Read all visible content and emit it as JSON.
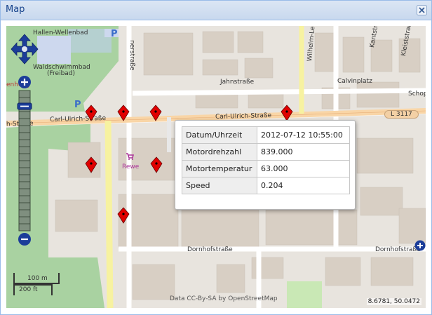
{
  "window": {
    "title": "Map"
  },
  "streets": {
    "hallenbad": "Hallen-Wellenbad",
    "waldschwimmbad": "Waldschwimmbad",
    "freibad": "(Freibad)",
    "jahnstrasse": "Jahnstraße",
    "carl_ulrich_1": "Carl-Ulrich-Straße",
    "carl_ulrich_2": "Carl-Ulrich-Straße",
    "carl_ulrich_left": "h-Straße",
    "calvinplatz": "Calvinplatz",
    "kantstrasse": "Kantstraße",
    "kleiststrasse": "Kleiststraße",
    "schop": "Schop",
    "wilhelm": "Wilhelm-Leus",
    "nerstrasse": "nerstraße",
    "rewe": "Rewe",
    "dornhof1": "Dornhofstraße",
    "dornhof2": "Dornhofstraße",
    "l3117": "L 3117",
    "enheiig": "enheiig"
  },
  "popup": {
    "rows": [
      {
        "key": "Datum/Uhrzeit",
        "value": "2012-07-12 10:55:00"
      },
      {
        "key": "Motordrehzahl",
        "value": "839.000"
      },
      {
        "key": "Motortemperatur",
        "value": "63.000"
      },
      {
        "key": "Speed",
        "value": "0.204"
      }
    ]
  },
  "scale": {
    "metric": "100 m",
    "imperial": "200 ft"
  },
  "attribution": "Data CC-By-SA by OpenStreetMap",
  "coordinates": "8.6781, 50.0472",
  "icons": {
    "close": "close-icon",
    "pan": "pan-arrows-icon",
    "zoom_in": "zoom-in-icon",
    "zoom_out": "zoom-out-icon",
    "marker": "map-marker-icon",
    "parking": "parking-icon",
    "shop": "shopping-cart-icon"
  },
  "colors": {
    "marker": "#e00000",
    "title": "#15428b",
    "zoom": "#1c3d99"
  }
}
